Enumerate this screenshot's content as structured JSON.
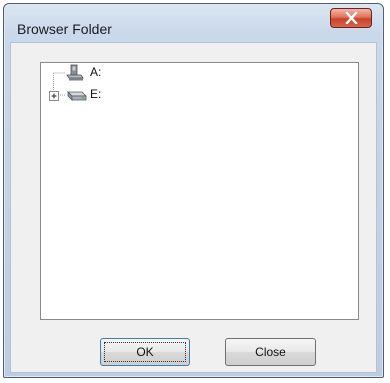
{
  "window": {
    "title": "Browser Folder"
  },
  "tree": {
    "items": [
      {
        "label": "A:",
        "icon": "floppy-drive-icon",
        "expandable": false
      },
      {
        "label": "E:",
        "icon": "hard-drive-icon",
        "expandable": true
      }
    ]
  },
  "buttons": {
    "ok_label": "OK",
    "close_label": "Close"
  }
}
